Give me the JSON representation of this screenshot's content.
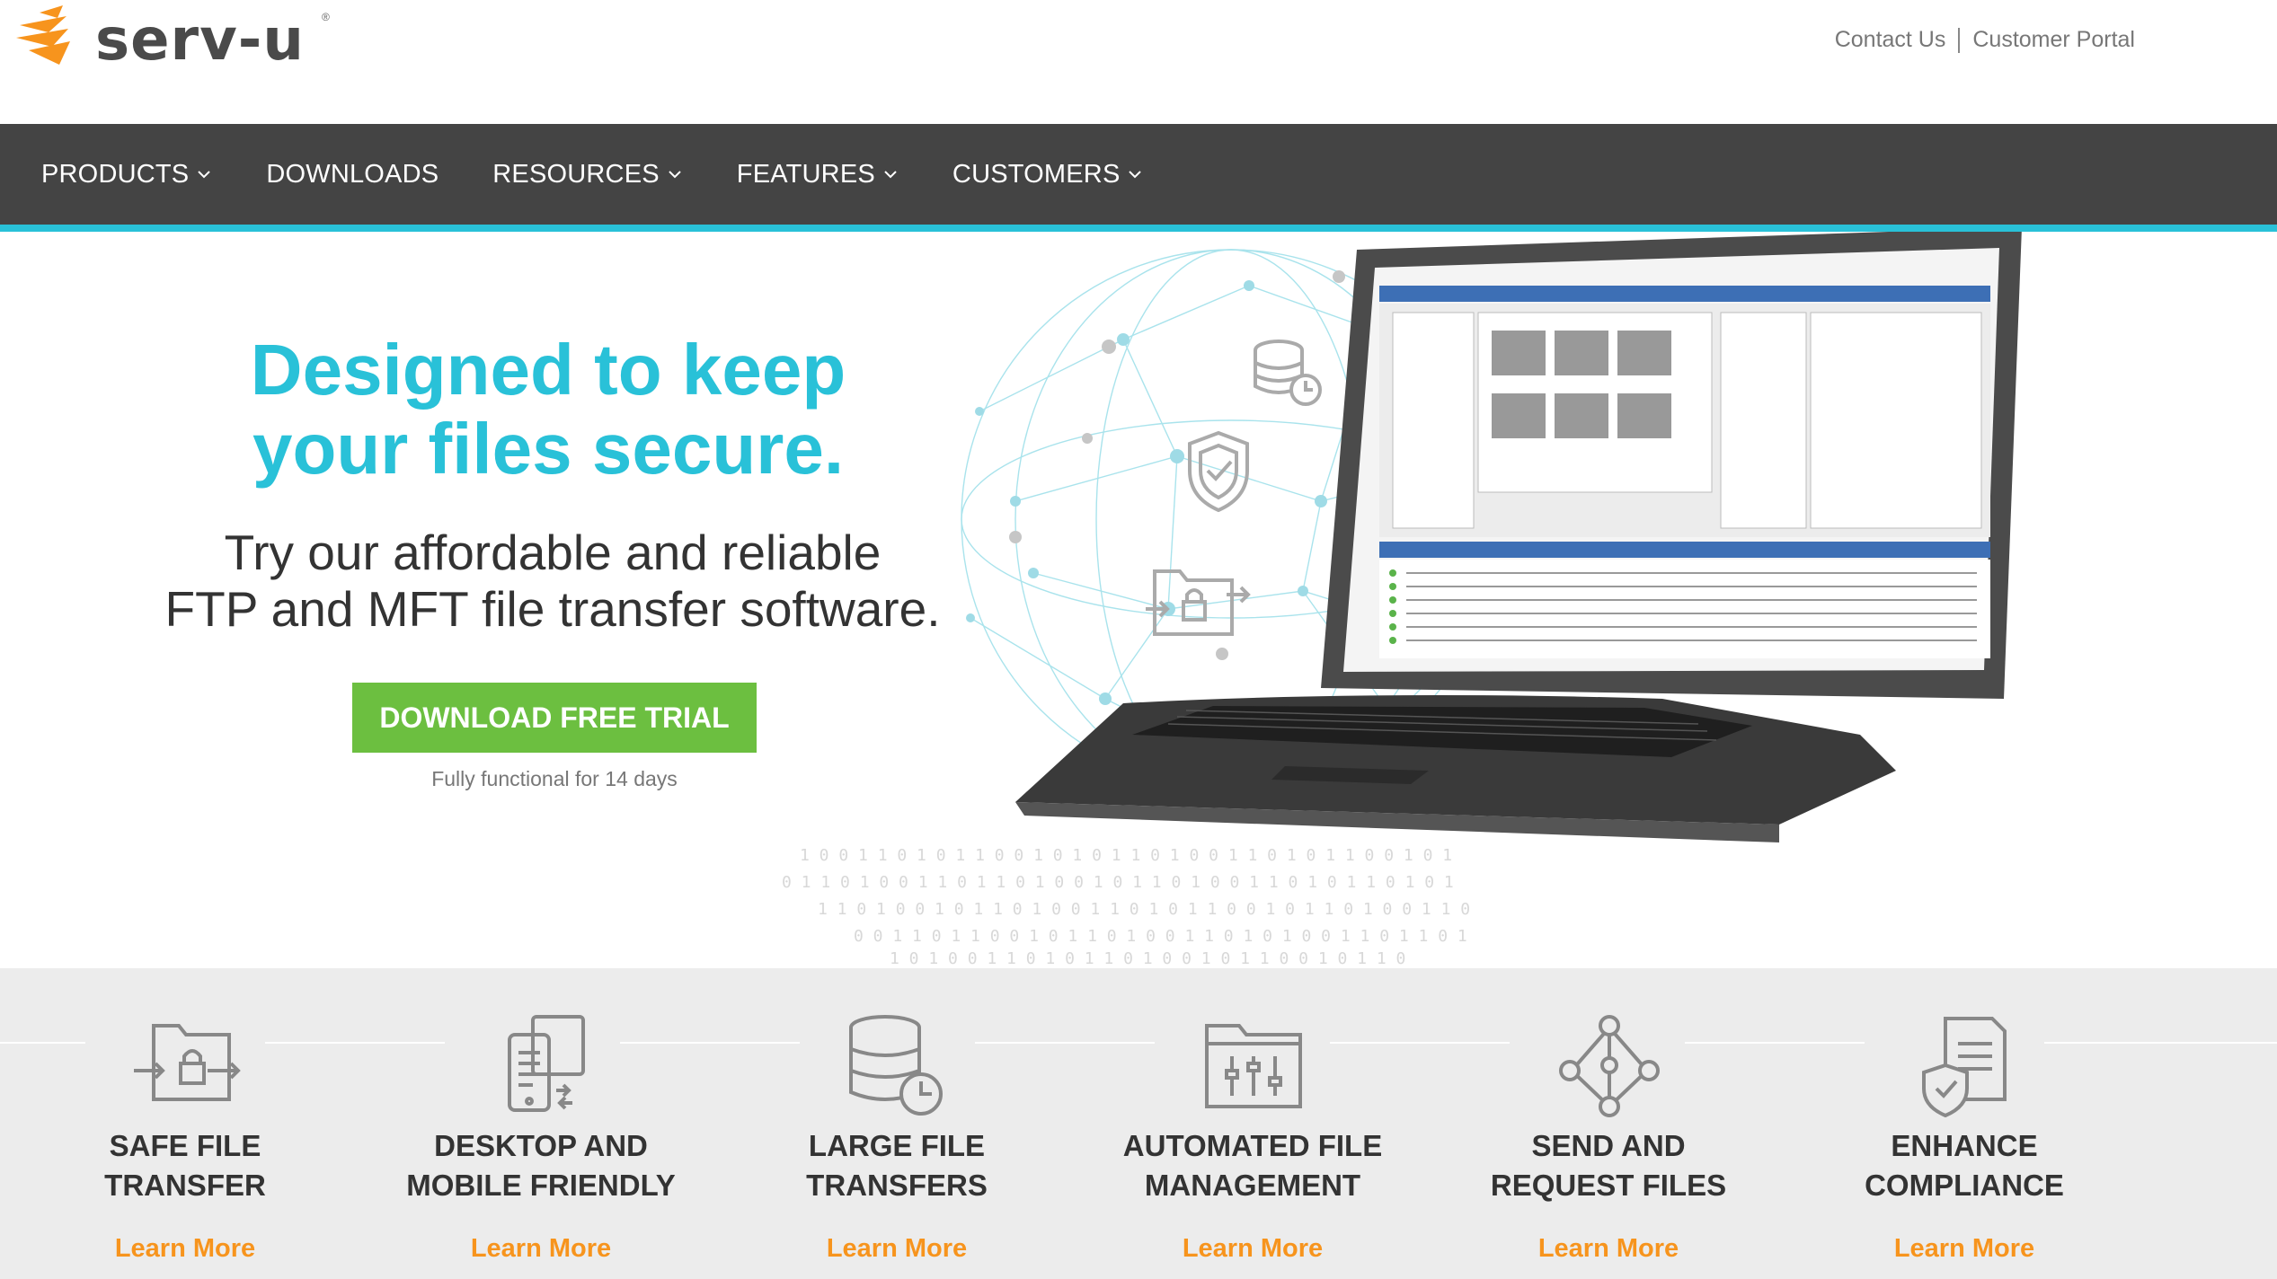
{
  "brand": {
    "name": "serv-u",
    "registered": "®",
    "accent_color": "#29c1d8",
    "logo_color": "#f7941d"
  },
  "header": {
    "links": [
      {
        "label": "Contact Us"
      },
      {
        "label": "Customer Portal"
      }
    ]
  },
  "nav": {
    "background": "#444444",
    "items": [
      {
        "label": "PRODUCTS",
        "has_dropdown": true
      },
      {
        "label": "DOWNLOADS",
        "has_dropdown": false
      },
      {
        "label": "RESOURCES",
        "has_dropdown": true
      },
      {
        "label": "FEATURES",
        "has_dropdown": true
      },
      {
        "label": "CUSTOMERS",
        "has_dropdown": true
      }
    ]
  },
  "hero": {
    "headline_line1": "Designed to keep",
    "headline_line2": "your files secure.",
    "sub_line1": "Try our affordable and reliable",
    "sub_line2": "FTP and MFT file transfer software.",
    "cta_label": "DOWNLOAD FREE TRIAL",
    "cta_color": "#6cbf40",
    "cta_note": "Fully functional for 14 days",
    "side_icons": [
      "database-clock-icon",
      "shield-check-icon",
      "folder-lock-transfer-icon"
    ]
  },
  "features": {
    "link_color": "#f7941d",
    "items": [
      {
        "icon": "folder-lock-transfer-icon",
        "title_line1": "SAFE FILE",
        "title_line2": "TRANSFER",
        "link": "Learn More"
      },
      {
        "icon": "devices-icon",
        "title_line1": "DESKTOP AND",
        "title_line2": "MOBILE FRIENDLY",
        "link": "Learn More"
      },
      {
        "icon": "database-clock-icon",
        "title_line1": "LARGE FILE",
        "title_line2": "TRANSFERS",
        "link": "Learn More"
      },
      {
        "icon": "folder-sliders-icon",
        "title_line1": "AUTOMATED FILE",
        "title_line2": "MANAGEMENT",
        "link": "Learn More"
      },
      {
        "icon": "share-network-icon",
        "title_line1": "SEND AND",
        "title_line2": "REQUEST FILES",
        "link": "Learn More"
      },
      {
        "icon": "document-shield-icon",
        "title_line1": "ENHANCE",
        "title_line2": "COMPLIANCE",
        "link": "Learn More"
      }
    ]
  }
}
